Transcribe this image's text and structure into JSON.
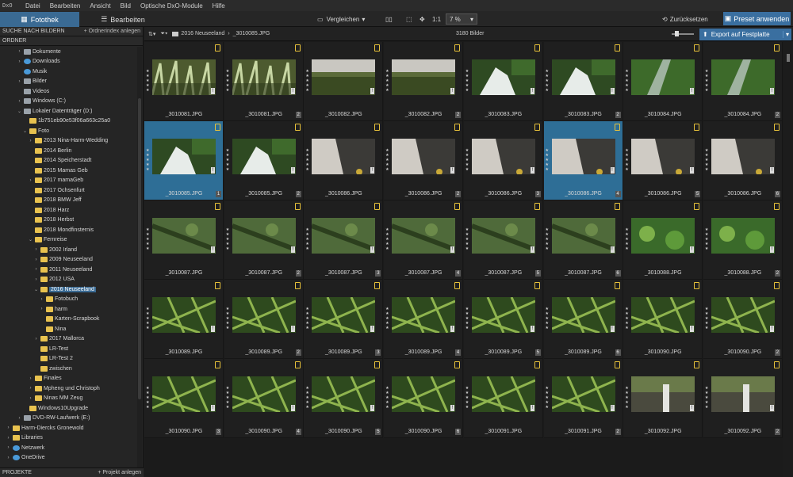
{
  "app_logo": "DxO",
  "menu": [
    "Datei",
    "Bearbeiten",
    "Ansicht",
    "Bild",
    "Optische DxO-Module",
    "Hilfe"
  ],
  "tabs": {
    "library": "Fotothek",
    "edit": "Bearbeiten"
  },
  "toolbar": {
    "compare": "Vergleichen",
    "zoom_ratio": "1:1",
    "zoom_value": "7 %",
    "reset": "Zurücksetzen",
    "preset": "Preset anwenden"
  },
  "sidebar": {
    "search_header": "SUCHE NACH BILDERN",
    "index_action": "+ Ordnerindex anlegen",
    "folders_header": "ORDNER",
    "projects_header": "PROJEKTE",
    "projects_action": "+ Projekt anlegen"
  },
  "tree": [
    {
      "label": "Dokumente",
      "indent": 3,
      "type": "doc",
      "arrow": "›"
    },
    {
      "label": "Downloads",
      "indent": 3,
      "type": "down",
      "arrow": "›"
    },
    {
      "label": "Musik",
      "indent": 3,
      "type": "music",
      "arrow": ""
    },
    {
      "label": "Bilder",
      "indent": 3,
      "type": "doc",
      "arrow": "›"
    },
    {
      "label": "Videos",
      "indent": 3,
      "type": "doc",
      "arrow": ""
    },
    {
      "label": "Windows (C:)",
      "indent": 3,
      "type": "drive",
      "arrow": "›"
    },
    {
      "label": "Lokaler Datenträger (D:)",
      "indent": 3,
      "type": "drive",
      "arrow": "⌄"
    },
    {
      "label": "1b751eb90e53f06a663c25a0",
      "indent": 4,
      "type": "folder",
      "arrow": ""
    },
    {
      "label": "Foto",
      "indent": 4,
      "type": "folder",
      "arrow": "⌄"
    },
    {
      "label": "2013 Nina-Harm-Wedding",
      "indent": 5,
      "type": "folder",
      "arrow": "›"
    },
    {
      "label": "2014 Berlin",
      "indent": 5,
      "type": "folder",
      "arrow": ""
    },
    {
      "label": "2014 Speicherstadt",
      "indent": 5,
      "type": "folder",
      "arrow": ""
    },
    {
      "label": "2015 Mamas Geb",
      "indent": 5,
      "type": "folder",
      "arrow": ""
    },
    {
      "label": "2017 mamaGeb",
      "indent": 5,
      "type": "folder",
      "arrow": "›"
    },
    {
      "label": "2017 Ochsenfurt",
      "indent": 5,
      "type": "folder",
      "arrow": ""
    },
    {
      "label": "2018 BMW Jeff",
      "indent": 5,
      "type": "folder",
      "arrow": ""
    },
    {
      "label": "2018 Harz",
      "indent": 5,
      "type": "folder",
      "arrow": ""
    },
    {
      "label": "2018 Herbst",
      "indent": 5,
      "type": "folder",
      "arrow": ""
    },
    {
      "label": "2018 Mondfinsternis",
      "indent": 5,
      "type": "folder",
      "arrow": ""
    },
    {
      "label": "Fernreise",
      "indent": 5,
      "type": "folder",
      "arrow": "⌄"
    },
    {
      "label": "2002 Irland",
      "indent": 6,
      "type": "folder",
      "arrow": "›"
    },
    {
      "label": "2009 Neuseeland",
      "indent": 6,
      "type": "folder",
      "arrow": "›"
    },
    {
      "label": "2011 Neuseeland",
      "indent": 6,
      "type": "folder",
      "arrow": "›"
    },
    {
      "label": "2012 USA",
      "indent": 6,
      "type": "folder",
      "arrow": "›"
    },
    {
      "label": "2016 Neuseeland",
      "indent": 6,
      "type": "folder",
      "arrow": "⌄",
      "selected": true
    },
    {
      "label": "Fotobuch",
      "indent": 7,
      "type": "folder",
      "arrow": "›"
    },
    {
      "label": "harm",
      "indent": 7,
      "type": "folder",
      "arrow": "›"
    },
    {
      "label": "Karten-Scrapbook",
      "indent": 7,
      "type": "folder",
      "arrow": ""
    },
    {
      "label": "Nina",
      "indent": 7,
      "type": "folder",
      "arrow": ""
    },
    {
      "label": "2017 Mallorca",
      "indent": 6,
      "type": "folder",
      "arrow": "›"
    },
    {
      "label": "LR-Test",
      "indent": 6,
      "type": "folder",
      "arrow": ""
    },
    {
      "label": "LR-Test 2",
      "indent": 6,
      "type": "folder",
      "arrow": ""
    },
    {
      "label": "zwischen",
      "indent": 6,
      "type": "folder",
      "arrow": ""
    },
    {
      "label": "Finales",
      "indent": 5,
      "type": "folder",
      "arrow": "›"
    },
    {
      "label": "Mpheng und Christoph",
      "indent": 5,
      "type": "folder",
      "arrow": "›"
    },
    {
      "label": "Ninas MM Zeug",
      "indent": 5,
      "type": "folder",
      "arrow": "›"
    },
    {
      "label": "Windows10Upgrade",
      "indent": 4,
      "type": "folder",
      "arrow": ""
    },
    {
      "label": "DVD-RW-Laufwerk (E:)",
      "indent": 3,
      "type": "drive",
      "arrow": "›"
    },
    {
      "label": "Harm-Diercks Gronewold",
      "indent": 1,
      "type": "folder",
      "arrow": "›"
    },
    {
      "label": "Libraries",
      "indent": 1,
      "type": "folder",
      "arrow": "›"
    },
    {
      "label": "Netzwerk",
      "indent": 1,
      "type": "net",
      "arrow": "›"
    },
    {
      "label": "OneDrive",
      "indent": 1,
      "type": "cloud",
      "arrow": "›"
    }
  ],
  "path": {
    "folder": "2016 Neuseeland",
    "separator": "›",
    "file": "_3010085.JPG"
  },
  "image_count": "3180 Bilder",
  "export_label": "Export auf Festplatte",
  "thumbnails": [
    {
      "name": "_3010081.JPG",
      "v": "",
      "scene": "grass"
    },
    {
      "name": "_3010081.JPG",
      "v": "2",
      "scene": "grass"
    },
    {
      "name": "_3010082.JPG",
      "v": "",
      "scene": "field"
    },
    {
      "name": "_3010082.JPG",
      "v": "2",
      "scene": "field"
    },
    {
      "name": "_3010083.JPG",
      "v": "",
      "scene": "waterfall"
    },
    {
      "name": "_3010083.JPG",
      "v": "2",
      "scene": "waterfall"
    },
    {
      "name": "_3010084.JPG",
      "v": "",
      "scene": "creek"
    },
    {
      "name": "_3010084.JPG",
      "v": "2",
      "scene": "creek"
    },
    {
      "name": "_3010085.JPG",
      "v": "1",
      "scene": "waterfall",
      "sel": true
    },
    {
      "name": "_3010085.JPG",
      "v": "2",
      "scene": "waterfall"
    },
    {
      "name": "_3010086.JPG",
      "v": "",
      "scene": "rock"
    },
    {
      "name": "_3010086.JPG",
      "v": "2",
      "scene": "rock"
    },
    {
      "name": "_3010086.JPG",
      "v": "3",
      "scene": "rock"
    },
    {
      "name": "_3010086.JPG",
      "v": "4",
      "scene": "rock",
      "sel": true
    },
    {
      "name": "_3010086.JPG",
      "v": "5",
      "scene": "rock"
    },
    {
      "name": "_3010086.JPG",
      "v": "6",
      "scene": "rock"
    },
    {
      "name": "_3010087.JPG",
      "v": "",
      "scene": "forest"
    },
    {
      "name": "_3010087.JPG",
      "v": "2",
      "scene": "forest"
    },
    {
      "name": "_3010087.JPG",
      "v": "3",
      "scene": "forest"
    },
    {
      "name": "_3010087.JPG",
      "v": "4",
      "scene": "forest"
    },
    {
      "name": "_3010087.JPG",
      "v": "5",
      "scene": "forest"
    },
    {
      "name": "_3010087.JPG",
      "v": "6",
      "scene": "forest"
    },
    {
      "name": "_3010088.JPG",
      "v": "",
      "scene": "moss"
    },
    {
      "name": "_3010088.JPG",
      "v": "2",
      "scene": "moss"
    },
    {
      "name": "_3010089.JPG",
      "v": "",
      "scene": "fern"
    },
    {
      "name": "_3010089.JPG",
      "v": "2",
      "scene": "fern"
    },
    {
      "name": "_3010089.JPG",
      "v": "3",
      "scene": "fern"
    },
    {
      "name": "_3010089.JPG",
      "v": "4",
      "scene": "fern"
    },
    {
      "name": "_3010089.JPG",
      "v": "5",
      "scene": "fern"
    },
    {
      "name": "_3010089.JPG",
      "v": "6",
      "scene": "fern"
    },
    {
      "name": "_3010090.JPG",
      "v": "",
      "scene": "fern"
    },
    {
      "name": "_3010090.JPG",
      "v": "2",
      "scene": "fern"
    },
    {
      "name": "_3010090.JPG",
      "v": "3",
      "scene": "fern"
    },
    {
      "name": "_3010090.JPG",
      "v": "4",
      "scene": "fern"
    },
    {
      "name": "_3010090.JPG",
      "v": "5",
      "scene": "fern"
    },
    {
      "name": "_3010090.JPG",
      "v": "6",
      "scene": "fern"
    },
    {
      "name": "_3010091.JPG",
      "v": "",
      "scene": "fern"
    },
    {
      "name": "_3010091.JPG",
      "v": "2",
      "scene": "fern"
    },
    {
      "name": "_3010092.JPG",
      "v": "",
      "scene": "cliff"
    },
    {
      "name": "_3010092.JPG",
      "v": "2",
      "scene": "cliff"
    }
  ],
  "colors": {
    "accent": "#3a6fa0",
    "selection": "#2e6e96",
    "badge": "#e8c23a",
    "folder": "#e8c24f"
  }
}
